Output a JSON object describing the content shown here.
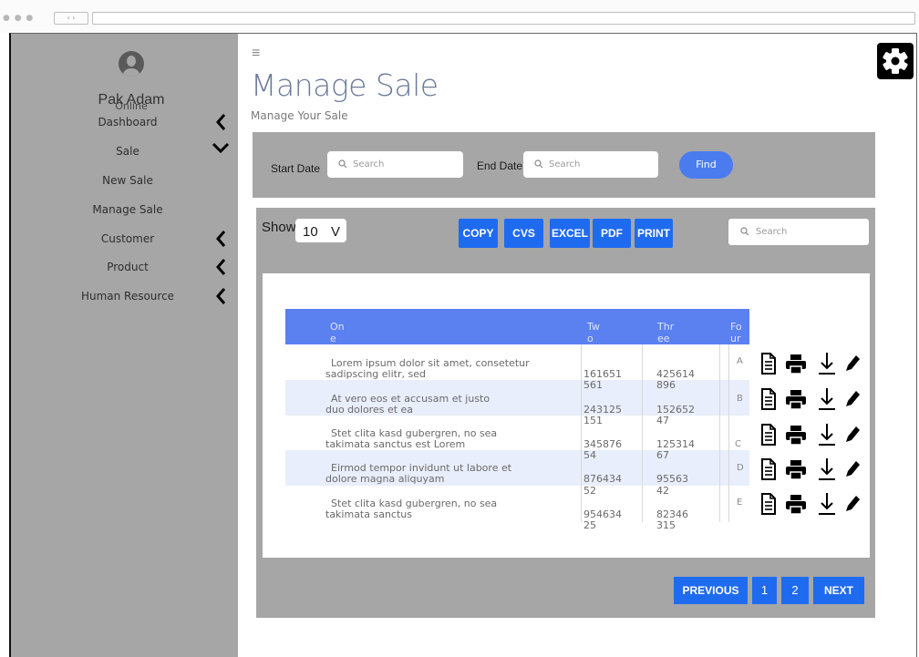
{
  "user": {
    "name": "Pak Adam",
    "status": "Online"
  },
  "sidebar": {
    "items": [
      {
        "label": "Dashboard",
        "chevron": "left"
      },
      {
        "label": "Sale",
        "chevron": "down"
      },
      {
        "label": "New Sale",
        "chevron": ""
      },
      {
        "label": "Manage Sale",
        "chevron": ""
      },
      {
        "label": "Customer",
        "chevron": "left"
      },
      {
        "label": "Product",
        "chevron": "left"
      },
      {
        "label": "Human Resource",
        "chevron": "left"
      }
    ]
  },
  "header": {
    "menu_icon": "≡",
    "title": "Manage Sale",
    "subtitle": "Manage Your Sale",
    "settings_icon": "gear-icon"
  },
  "filter": {
    "start_label": "Start Date",
    "start_placeholder": "Search",
    "end_label": "End Date",
    "end_placeholder": "Search",
    "find_label": "Find"
  },
  "table_controls": {
    "show_label": "Show",
    "show_value": "10",
    "show_arrow": "V",
    "buttons": [
      "COPY",
      "CVS",
      "EXCEL",
      "PDF",
      "PRINT"
    ],
    "search_placeholder": "Search"
  },
  "table": {
    "headers": [
      {
        "line1": "On",
        "line2": "e"
      },
      {
        "line1": "Tw",
        "line2": "o"
      },
      {
        "line1": "Thr",
        "line2": "ee"
      },
      {
        "line1": "Fo",
        "line2": "ur"
      }
    ],
    "rows": [
      {
        "one_a": "Lorem ipsum dolor sit amet, consetetur",
        "one_b": "sadipscing elitr, sed",
        "two_a": "161651",
        "two_b": "561",
        "three_a": "425614",
        "three_b": "896",
        "four": "A"
      },
      {
        "one_a": "At vero eos et accusam et justo",
        "one_b": "duo dolores et ea",
        "two_a": "243125",
        "two_b": "151",
        "three_a": "152652",
        "three_b": "47",
        "four": "B"
      },
      {
        "one_a": "Stet clita kasd gubergren, no sea",
        "one_b": "takimata sanctus est Lorem",
        "two_a": "345876",
        "two_b": "54",
        "three_a": "125314",
        "three_b": "67",
        "four": "C"
      },
      {
        "one_a": "Eirmod tempor invidunt ut labore et",
        "one_b": "dolore magna aliquyam",
        "two_a": "876434",
        "two_b": "52",
        "three_a": "95563",
        "three_b": "42",
        "four": "D"
      },
      {
        "one_a": "Stet clita kasd gubergren, no sea",
        "one_b": "takimata sanctus",
        "two_a": "954634",
        "two_b": "25",
        "three_a": "82346",
        "three_b": "315",
        "four": "E"
      }
    ],
    "row_actions": [
      "document-icon",
      "print-icon",
      "download-icon",
      "edit-icon"
    ]
  },
  "pagination": {
    "previous": "PREVIOUS",
    "pages": [
      "1",
      "2"
    ],
    "next": "NEXT"
  },
  "colors": {
    "sidebar": "#a6a6a6",
    "accent_blue": "#1f6bf0",
    "header_blue": "#5b80f0",
    "row_stripe": "#e9eefc",
    "title": "#6b7a99"
  }
}
